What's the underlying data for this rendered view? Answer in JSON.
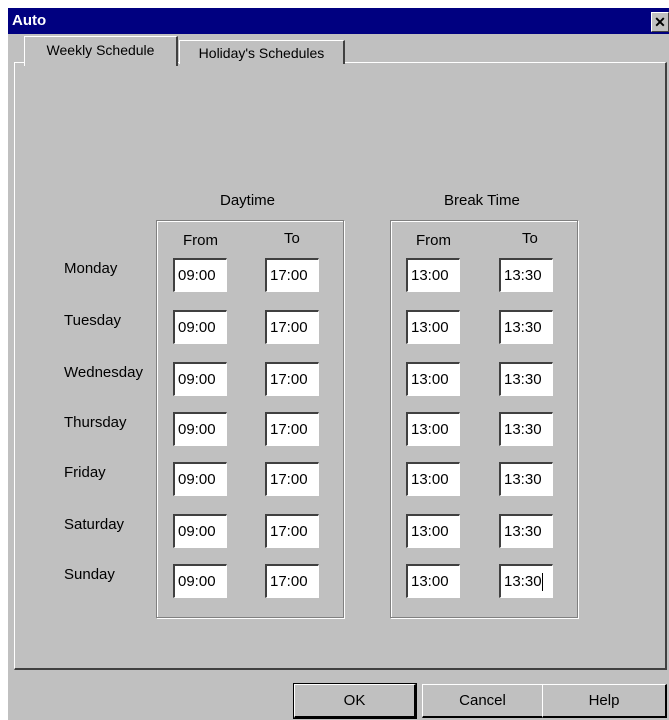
{
  "window": {
    "title": "Auto",
    "close_icon": "close-icon"
  },
  "tabs": [
    {
      "label": "Weekly Schedule",
      "active": true
    },
    {
      "label": "Holiday's Schedules",
      "active": false
    }
  ],
  "groups": {
    "daytime": {
      "title": "Daytime",
      "from_label": "From",
      "to_label": "To"
    },
    "break": {
      "title": "Break Time",
      "from_label": "From",
      "to_label": "To"
    }
  },
  "days": [
    {
      "name": "Monday",
      "day_from": "09:00",
      "day_to": "17:00",
      "break_from": "13:00",
      "break_to": "13:30"
    },
    {
      "name": "Tuesday",
      "day_from": "09:00",
      "day_to": "17:00",
      "break_from": "13:00",
      "break_to": "13:30"
    },
    {
      "name": "Wednesday",
      "day_from": "09:00",
      "day_to": "17:00",
      "break_from": "13:00",
      "break_to": "13:30"
    },
    {
      "name": "Thursday",
      "day_from": "09:00",
      "day_to": "17:00",
      "break_from": "13:00",
      "break_to": "13:30"
    },
    {
      "name": "Friday",
      "day_from": "09:00",
      "day_to": "17:00",
      "break_from": "13:00",
      "break_to": "13:30"
    },
    {
      "name": "Saturday",
      "day_from": "09:00",
      "day_to": "17:00",
      "break_from": "13:00",
      "break_to": "13:30"
    },
    {
      "name": "Sunday",
      "day_from": "09:00",
      "day_to": "17:00",
      "break_from": "13:00",
      "break_to": "13:30"
    }
  ],
  "buttons": {
    "ok": "OK",
    "cancel": "Cancel",
    "help": "Help"
  }
}
